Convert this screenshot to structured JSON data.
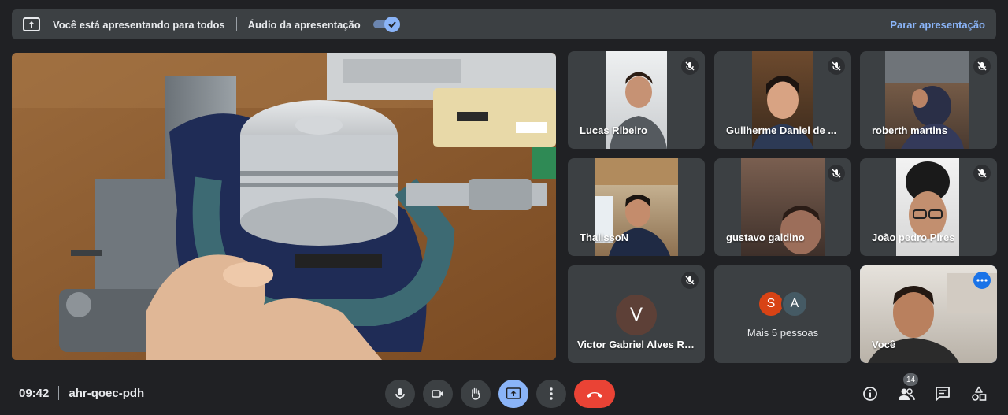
{
  "banner": {
    "message": "Você está apresentando para todos",
    "audio_label": "Áudio da apresentação",
    "audio_enabled": true,
    "stop_label": "Parar apresentação"
  },
  "participants": [
    {
      "name": "Lucas Ribeiro",
      "muted": true
    },
    {
      "name": "Guilherme Daniel de ...",
      "muted": true
    },
    {
      "name": "roberth martins",
      "muted": true
    },
    {
      "name": "ThalissoN",
      "muted": false
    },
    {
      "name": "gustavo galdino",
      "muted": true
    },
    {
      "name": "João pedro Pires",
      "muted": true
    },
    {
      "name": "Victor Gabriel Alves Ri...",
      "initial": "V",
      "muted": true
    },
    {
      "more_label": "Mais 5 pessoas",
      "initials": [
        "S",
        "A"
      ]
    },
    {
      "name": "Você"
    }
  ],
  "bottom": {
    "time": "09:42",
    "meeting_code": "ahr-qoec-pdh",
    "participant_count": "14"
  },
  "colors": {
    "accent": "#8ab4f8",
    "end_call": "#ea4335",
    "avatar_v": "#5d4037",
    "avatar_s": "#d84315",
    "avatar_a": "#455a64"
  }
}
